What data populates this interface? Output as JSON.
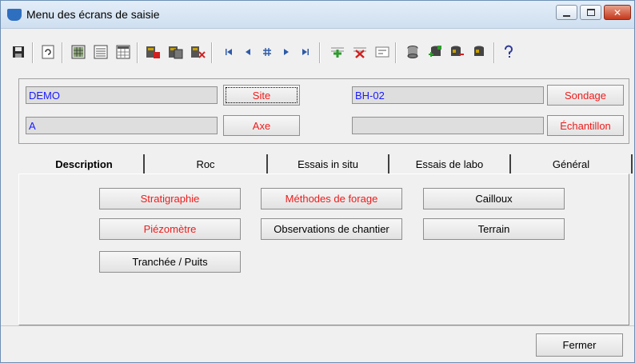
{
  "window": {
    "title": "Menu des écrans de saisie",
    "accent_color": "#2e6fc0",
    "controls": [
      "minimize-icon",
      "maximize-icon",
      "close-icon"
    ]
  },
  "toolbar": {
    "icons": [
      "save-icon",
      "refresh-icon",
      "grid-view-icon",
      "form-view-icon",
      "table-view-icon",
      "delete-record-icon",
      "copy-record-icon",
      "remove-record-icon",
      "first-record-icon",
      "previous-record-icon",
      "go-to-record-icon",
      "next-record-icon",
      "last-record-icon",
      "add-icon",
      "cancel-icon",
      "filter-icon",
      "database-icon",
      "database-add-icon",
      "database-import-icon",
      "database-export-icon",
      "help-icon"
    ]
  },
  "header": {
    "site": {
      "value": "DEMO",
      "button": "Site"
    },
    "axe": {
      "value": "A",
      "button": "Axe"
    },
    "sondage": {
      "value": "BH-02",
      "button": "Sondage"
    },
    "echantillon": {
      "value": "",
      "button": "Échantillon"
    },
    "value_color": "#1a1aff",
    "label_color": "#ee1c1c"
  },
  "tabs": [
    {
      "label": "Description",
      "active": true
    },
    {
      "label": "Roc",
      "active": false
    },
    {
      "label": "Essais in situ",
      "active": false
    },
    {
      "label": "Essais de labo",
      "active": false
    },
    {
      "label": "Général",
      "active": false
    }
  ],
  "description_buttons": {
    "stratigraphie": "Stratigraphie",
    "methodes_forage": "Méthodes de forage",
    "cailloux": "Cailloux",
    "piezometre": "Piézomètre",
    "observations": "Observations de chantier",
    "terrain": "Terrain",
    "tranchee": "Tranchée / Puits"
  },
  "footer": {
    "close_label": "Fermer"
  }
}
